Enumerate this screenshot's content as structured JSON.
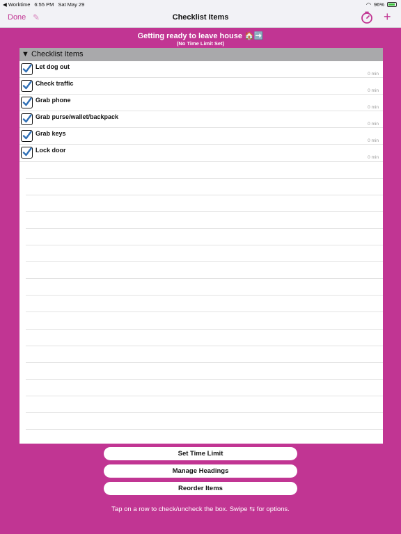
{
  "status": {
    "app": "◀ Worktime",
    "time": "6:55 PM",
    "date": "Sat May 29",
    "battery": "96%"
  },
  "nav": {
    "done": "Done",
    "title": "Checklist Items",
    "add": "+"
  },
  "list": {
    "title": "Getting ready to leave house 🏠➡️",
    "subtitle": "(No Time Limit Set)"
  },
  "section": {
    "label": "▼ Checklist Items"
  },
  "items": [
    {
      "label": "Let dog out",
      "time": "0 min"
    },
    {
      "label": "Check traffic",
      "time": "0 min"
    },
    {
      "label": "Grab phone",
      "time": "0 min"
    },
    {
      "label": "Grab purse/wallet/backpack",
      "time": "0 min"
    },
    {
      "label": "Grab keys",
      "time": "0 min"
    },
    {
      "label": "Lock door",
      "time": "0 min"
    }
  ],
  "buttons": {
    "set_time_limit": "Set Time Limit",
    "manage_headings": "Manage Headings",
    "reorder_items": "Reorder Items"
  },
  "hint": "Tap on a row to check/uncheck the box. Swipe ⇆ for options.",
  "colors": {
    "accent": "#c13593",
    "check": "#2f6fb5"
  }
}
